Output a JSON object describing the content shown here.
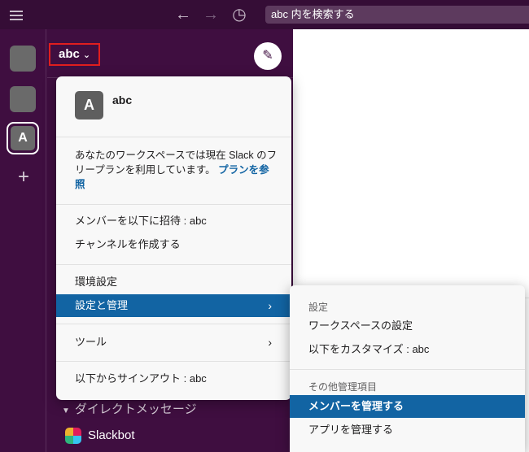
{
  "topbar": {
    "search_placeholder": "abc 内を検索する",
    "back_icon": "←",
    "forward_icon": "→",
    "history_icon": "◷"
  },
  "rail": {
    "active_workspace_initial": "A",
    "add_icon": "+"
  },
  "sidebar": {
    "workspace_name": "abc",
    "workspace_chevron": "⌄",
    "compose_icon": "✎",
    "dm_section_arrow": "▼",
    "dm_section_label": "ダイレクトメッセージ",
    "slackbot_label": "Slackbot"
  },
  "menu": {
    "avatar_initial": "A",
    "workspace_name": "abc",
    "plan_text": "あなたのワークスペースでは現在 Slack のフリープランを利用しています。",
    "plan_link": "プランを参照",
    "invite_label": "メンバーを以下に招待 : abc",
    "create_channel_label": "チャンネルを作成する",
    "preferences_label": "環境設定",
    "settings_admin_label": "設定と管理",
    "tools_label": "ツール",
    "signout_label": "以下からサインアウト : abc",
    "arrow": "›"
  },
  "submenu": {
    "section_settings": "設定",
    "workspace_settings_label": "ワークスペースの設定",
    "customize_label": "以下をカスタマイズ : abc",
    "section_other_admin": "その他管理項目",
    "manage_members_label": "メンバーを管理する",
    "manage_apps_label": "アプリを管理する"
  },
  "colors": {
    "aubergine": "#3f0e40",
    "topbar": "#350d36",
    "accent_blue": "#1264a3",
    "highlight_red": "#e01e1e"
  }
}
